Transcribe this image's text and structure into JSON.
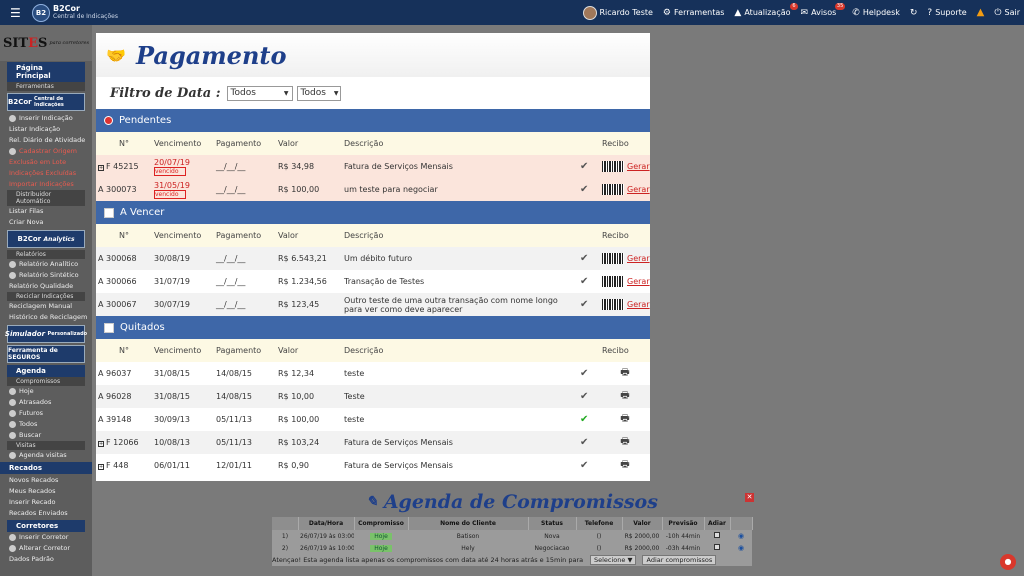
{
  "topbar": {
    "brand_title": "B2Cor",
    "brand_sub": "Central de Indicações",
    "user": "Ricardo Teste",
    "ferramentas": "Ferramentas",
    "atualizacao": "Atualização",
    "atualizacao_count": "6",
    "avisos": "Avisos",
    "avisos_count": "35",
    "helpdesk": "Helpdesk",
    "suporte": "Suporte",
    "sair": "Sair"
  },
  "sidebar": {
    "logo_a": "SIT",
    "logo_b": "E",
    "logo_c": "S",
    "logo_sub": "para corretores",
    "pagina_principal": "Página Principal",
    "ferramentas": "Ferramentas",
    "b2cor_block": "B2Cor",
    "b2cor_block_sub": "Central de Indicações",
    "inserir_indicacao": "Inserir Indicação",
    "listar_indicacao": "Listar Indicação",
    "rel_diario": "Rel. Diário de Atividade",
    "cadastrar_origem": "Cadastrar Origem",
    "exclusao_lote": "Exclusão em Lote",
    "indicacoes_excluidas": "Indicações Excluídas",
    "importar_indicacoes": "Importar Indicações",
    "distribuidor": "Distribuidor Automático",
    "listar_filas": "Listar Filas",
    "criar_nova": "Criar Nova",
    "analytics_block": "B2Cor",
    "analytics_block_sub": "Analytics",
    "relatorios": "Relatórios",
    "rel_analitico": "Relatório Analítico",
    "rel_sintetico": "Relatório Sintético",
    "rel_qualidade": "Relatório Qualidade",
    "reciclar": "Reciclar Indicações",
    "reciclagem_manual": "Reciclagem Manual",
    "historico_reciclagem": "Histórico de Reciclagem",
    "simulador": "Simulador",
    "simulador_sub": "Personalizado",
    "seguros": "Ferramenta de SEGUROS",
    "agenda": "Agenda",
    "compromissos": "Compromissos",
    "hoje": "Hoje",
    "atrasados": "Atrasados",
    "futuros": "Futuros",
    "todos": "Todos",
    "buscar": "Buscar",
    "visitas": "Visitas",
    "agenda_visitas": "Agenda visitas",
    "recados": "Recados",
    "novos_recados": "Novos Recados",
    "meus_recados": "Meus Recados",
    "inserir_recado": "Inserir Recado",
    "recados_enviados": "Recados Enviados",
    "corretores": "Corretores",
    "inserir_corretor": "Inserir Corretor",
    "alterar_corretor": "Alterar Corretor",
    "dados_padrao": "Dados Padrão"
  },
  "modal": {
    "title": "Pagamento",
    "filter_label": "Filtro de Data :",
    "filter1": "Todos",
    "filter2": "Todos",
    "columns": [
      "N°",
      "Vencimento",
      "Pagamento",
      "Valor",
      "Descrição",
      "Recibo"
    ],
    "gerar": "Gerar",
    "vencido": "vencido",
    "sections": {
      "pendentes": {
        "title": "Pendentes",
        "rows": [
          {
            "n": "F 45215",
            "venc": "20/07/19",
            "pag": "__/__/__",
            "valor": "R$ 34,98",
            "desc": "Fatura de Serviços Mensais"
          },
          {
            "n": "A 300073",
            "venc": "31/05/19",
            "pag": "__/__/__",
            "valor": "R$ 100,00",
            "desc": "um teste para negociar"
          }
        ]
      },
      "a_vencer": {
        "title": "A Vencer",
        "rows": [
          {
            "n": "A 300068",
            "venc": "30/08/19",
            "pag": "__/__/__",
            "valor": "R$ 6.543,21",
            "desc": "Um débito futuro"
          },
          {
            "n": "A 300066",
            "venc": "31/07/19",
            "pag": "__/__/__",
            "valor": "R$ 1.234,56",
            "desc": "Transação de Testes"
          },
          {
            "n": "A 300067",
            "venc": "30/07/19",
            "pag": "__/__/__",
            "valor": "R$ 123,45",
            "desc": "Outro teste de uma outra transação com nome longo para ver como deve aparecer"
          }
        ]
      },
      "quitados": {
        "title": "Quitados",
        "rows": [
          {
            "n": "A 96037",
            "venc": "31/08/15",
            "pag": "14/08/15",
            "valor": "R$ 12,34",
            "desc": "teste"
          },
          {
            "n": "A 96028",
            "venc": "31/08/15",
            "pag": "14/08/15",
            "valor": "R$ 10,00",
            "desc": "Teste"
          },
          {
            "n": "A 39148",
            "venc": "30/09/13",
            "pag": "05/11/13",
            "valor": "R$ 100,00",
            "desc": "teste"
          },
          {
            "n": "F 12066",
            "venc": "10/08/13",
            "pag": "05/11/13",
            "valor": "R$ 103,24",
            "desc": "Fatura de Serviços Mensais"
          },
          {
            "n": "F 448",
            "venc": "06/01/11",
            "pag": "12/01/11",
            "valor": "R$ 0,90",
            "desc": "Fatura de Serviços Mensais"
          }
        ]
      }
    }
  },
  "agenda": {
    "title": "Agenda de Compromissos",
    "columns": [
      "Data/Hora",
      "Compromisso",
      "Nome do Cliente",
      "Status",
      "Telefone",
      "Valor",
      "Previsão",
      "Adiar"
    ],
    "rows": [
      {
        "i": "1)",
        "data": "26/07/19 às 03:00",
        "comp": "Hoje",
        "cliente": "Batison",
        "status": "Nova",
        "tel": "()",
        "valor": "R$ 2000,00",
        "prev": "-10h 44min"
      },
      {
        "i": "2)",
        "data": "26/07/19 às 10:00",
        "comp": "Hoje",
        "cliente": "Hely",
        "status": "Negociacao",
        "tel": "()",
        "valor": "R$ 2000,00",
        "prev": "-03h 44min"
      }
    ],
    "footer": "Atençao! Esta agenda lista apenas os compromissos com data até 24 horas atrás e 15min para a frente.",
    "select": "Selecione",
    "button": "Adiar compromissos"
  }
}
